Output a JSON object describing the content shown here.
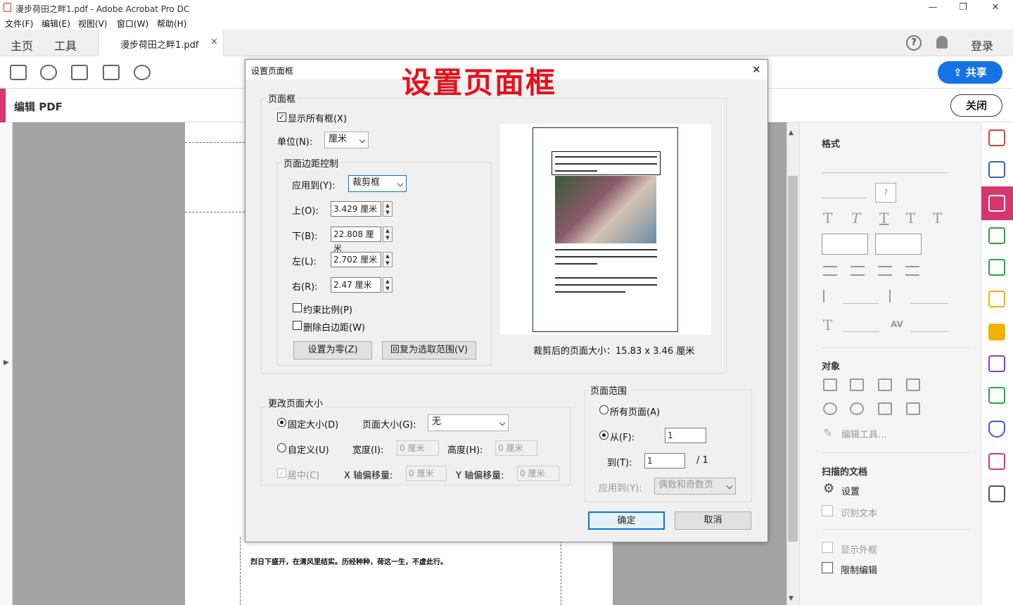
{
  "window": {
    "title": "漫步荷田之畔1.pdf - Adobe Acrobat Pro DC",
    "minimize": "—",
    "restore": "❐",
    "close": "✕"
  },
  "menu": [
    "文件(F)",
    "编辑(E)",
    "视图(V)",
    "窗口(W)",
    "帮助(H)"
  ],
  "tabs": {
    "home": "主页",
    "tools": "工具",
    "doc": "漫步荷田之畔1.pdf",
    "doc_close": "×",
    "login": "登录"
  },
  "toolbar": {
    "share": "共享"
  },
  "editbar": {
    "title": "编辑 PDF",
    "close": "关闭"
  },
  "document": {
    "bottom_text": "烈日下盛开，在清风里结实。历经种种，荷这一生，不虚此行。"
  },
  "annotation": {
    "overlay_title": "设置页面框",
    "color": "#e8101a"
  },
  "dialog": {
    "title": "设置页面框",
    "close": "✕",
    "page_box_group": "页面框",
    "show_all_boxes": "显示所有框(X)",
    "show_all_checked": true,
    "unit_label": "单位(N):",
    "unit_value": "厘米",
    "margin_group": "页面边距控制",
    "apply_to_label": "应用到(Y):",
    "apply_to_value": "裁剪框",
    "top_label": "上(O):",
    "top_value": "3.429 厘米",
    "bottom_label": "下(B):",
    "bottom_value": "22.808 厘米",
    "left_label": "左(L):",
    "left_value": "2.702 厘米",
    "right_label": "右(R):",
    "right_value": "2.47 厘米",
    "constrain": "约束比例(P)",
    "remove_white": "删除白边距(W)",
    "set_zero": "设置为零(Z)",
    "revert": "回复为选取范围(V)",
    "cropped_size": "裁剪后的页面大小：15.83 x 3.46 厘米",
    "change_size_group": "更改页面大小",
    "fixed_size": "固定大小(D)",
    "page_size_label": "页面大小(G):",
    "page_size_value": "无",
    "custom": "自定义(U)",
    "width_label": "宽度(I):",
    "width_value": "0 厘米",
    "height_label": "高度(H):",
    "height_value": "0 厘米",
    "center": "居中(C)",
    "x_offset_label": "X 轴偏移量:",
    "x_offset_value": "0 厘米",
    "y_offset_label": "Y 轴偏移量:",
    "y_offset_value": "0 厘米",
    "page_range_group": "页面范围",
    "all_pages": "所有页面(A)",
    "from_label": "从(F):",
    "from_value": "1",
    "to_label": "到(T):",
    "to_value": "1",
    "of_total": "/ 1",
    "apply_to2_label": "应用到(Y):",
    "apply_to2_value": "偶数和奇数页",
    "ok": "确定",
    "cancel": "取消"
  },
  "right_panel": {
    "format": "格式",
    "objects": "对象",
    "edit_tool": "编辑工具...",
    "scanned_docs": "扫描的文档",
    "settings": "设置",
    "recognize_text": "识别文本",
    "show_outline": "显示外框",
    "restrict_edit": "限制编辑",
    "av_label": "AV"
  },
  "right_strip_colors": [
    "#e0413b",
    "#3b5bdb",
    "#d7366f",
    "#28a745",
    "#28a745",
    "#f0b400",
    "#f0b400",
    "#7b3fe4",
    "#28a745",
    "#3b5bdb",
    "#d7366f",
    "#555555"
  ],
  "accent": "#1473e6"
}
